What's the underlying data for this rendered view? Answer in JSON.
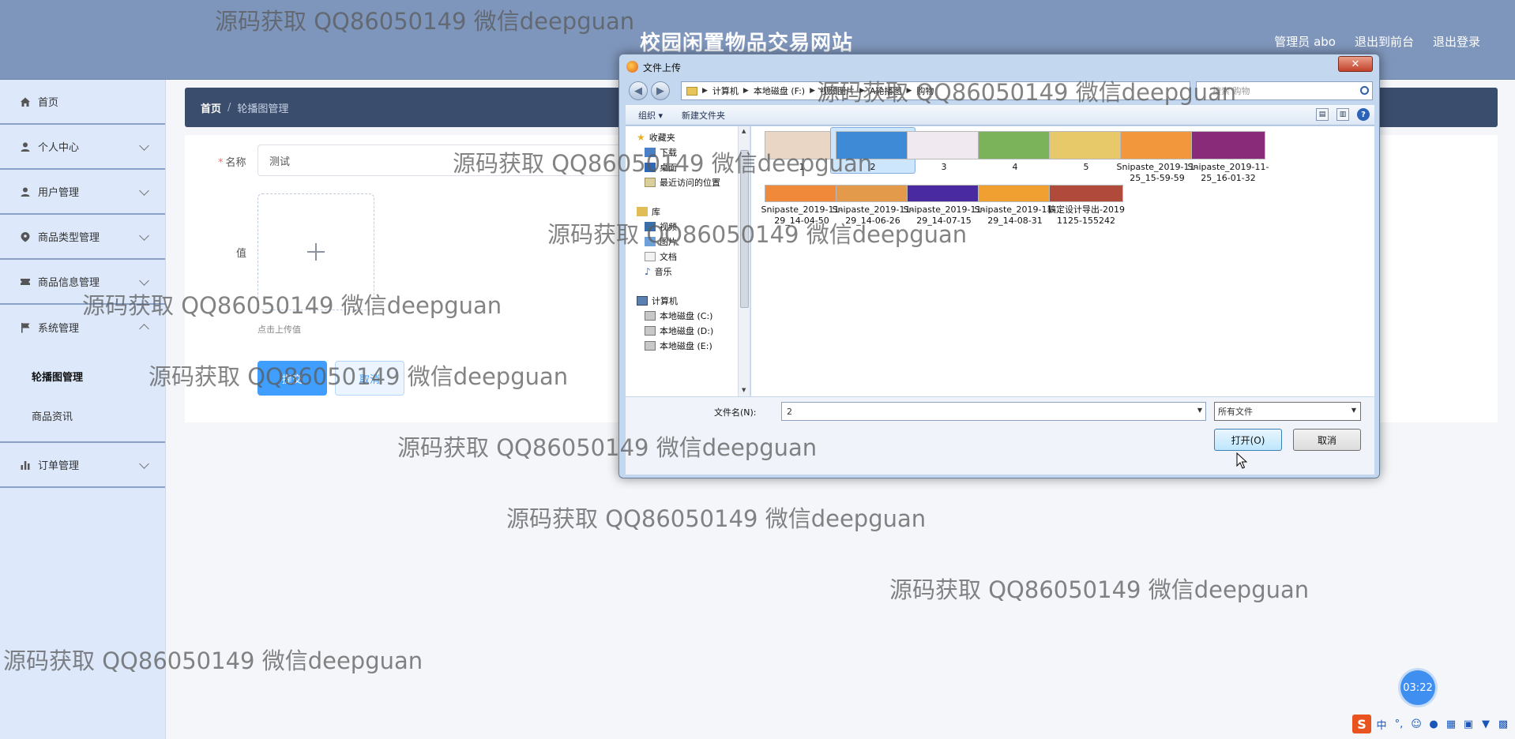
{
  "header": {
    "title": "校园闲置物品交易网站",
    "links": [
      "管理员 abo",
      "退出到前台",
      "退出登录"
    ]
  },
  "sidebar": {
    "items": [
      {
        "label": "首页",
        "icon": "home-icon"
      },
      {
        "label": "个人中心",
        "icon": "user-icon"
      },
      {
        "label": "用户管理",
        "icon": "user-icon"
      },
      {
        "label": "商品类型管理",
        "icon": "tag-icon"
      },
      {
        "label": "商品信息管理",
        "icon": "ticket-icon"
      },
      {
        "label": "系统管理",
        "icon": "flag-icon"
      },
      {
        "label": "订单管理",
        "icon": "bar-chart-icon"
      }
    ],
    "submenu": [
      "轮播图管理",
      "商品资讯"
    ]
  },
  "breadcrumb": {
    "home": "首页",
    "separator": "/",
    "current": "轮播图管理"
  },
  "form": {
    "name_label": "名称",
    "name_value": "测试",
    "value_label": "值",
    "upload_tip": "点击上传值",
    "submit_label": "提交",
    "cancel_label": "取消"
  },
  "dialog": {
    "title": "文件上传",
    "close": "✕",
    "path": [
      "计算机",
      "本地磁盘 (F:)",
      "视频图片",
      "A轮播图",
      "购物"
    ],
    "search_placeholder": "搜索 购物",
    "toolbar": {
      "organize": "组织 ▾",
      "new_folder": "新建文件夹",
      "help": "?"
    },
    "tree": [
      {
        "label": "收藏夹",
        "icon": "star-icon"
      },
      {
        "label": "下载",
        "icon": "download-folder-icon"
      },
      {
        "label": "桌面",
        "icon": "desktop-icon"
      },
      {
        "label": "最近访问的位置",
        "icon": "recent-places-icon"
      },
      {
        "label": "库",
        "icon": "library-icon"
      },
      {
        "label": "视频",
        "icon": "video-icon"
      },
      {
        "label": "图片",
        "icon": "picture-icon"
      },
      {
        "label": "文档",
        "icon": "document-icon"
      },
      {
        "label": "音乐",
        "icon": "music-icon"
      },
      {
        "label": "计算机",
        "icon": "computer-icon"
      },
      {
        "label": "本地磁盘 (C:)",
        "icon": "drive-icon"
      },
      {
        "label": "本地磁盘 (D:)",
        "icon": "drive-icon"
      },
      {
        "label": "本地磁盘 (E:)",
        "icon": "drive-icon"
      }
    ],
    "files": [
      {
        "name": "1",
        "color": "#e9d6c5",
        "selected": false
      },
      {
        "name": "2",
        "color": "#3f8ad6",
        "selected": true
      },
      {
        "name": "3",
        "color": "#f0eaf0",
        "selected": false
      },
      {
        "name": "4",
        "color": "#7bb35a",
        "selected": false
      },
      {
        "name": "5",
        "color": "#e8c96a",
        "selected": false
      },
      {
        "name": "Snipaste_2019-11-25_15-59-59",
        "color": "#f3973c",
        "selected": false
      },
      {
        "name": "Snipaste_2019-11-25_16-01-32",
        "color": "#8a2b7a",
        "selected": false
      },
      {
        "name": "Snipaste_2019-11-29_14-04-50",
        "color": "#f08a3a",
        "selected": false
      },
      {
        "name": "Snipaste_2019-11-29_14-06-26",
        "color": "#e39a4a",
        "selected": false
      },
      {
        "name": "Snipaste_2019-11-29_14-07-15",
        "color": "#4a2aa0",
        "selected": false
      },
      {
        "name": "Snipaste_2019-11-29_14-08-31",
        "color": "#f0a030",
        "selected": false
      },
      {
        "name": "稿定设计导出-20191125-155242",
        "color": "#b04a3a",
        "selected": false
      }
    ],
    "filename_label": "文件名(N):",
    "filename_value": "2",
    "filetype_value": "所有文件",
    "open_label": "打开(O)",
    "cancel_label": "取消"
  },
  "timer": "03:22",
  "ime": {
    "logo": "S",
    "mode": "中"
  },
  "watermark": "源码获取 QQ86050149 微信deepguan"
}
